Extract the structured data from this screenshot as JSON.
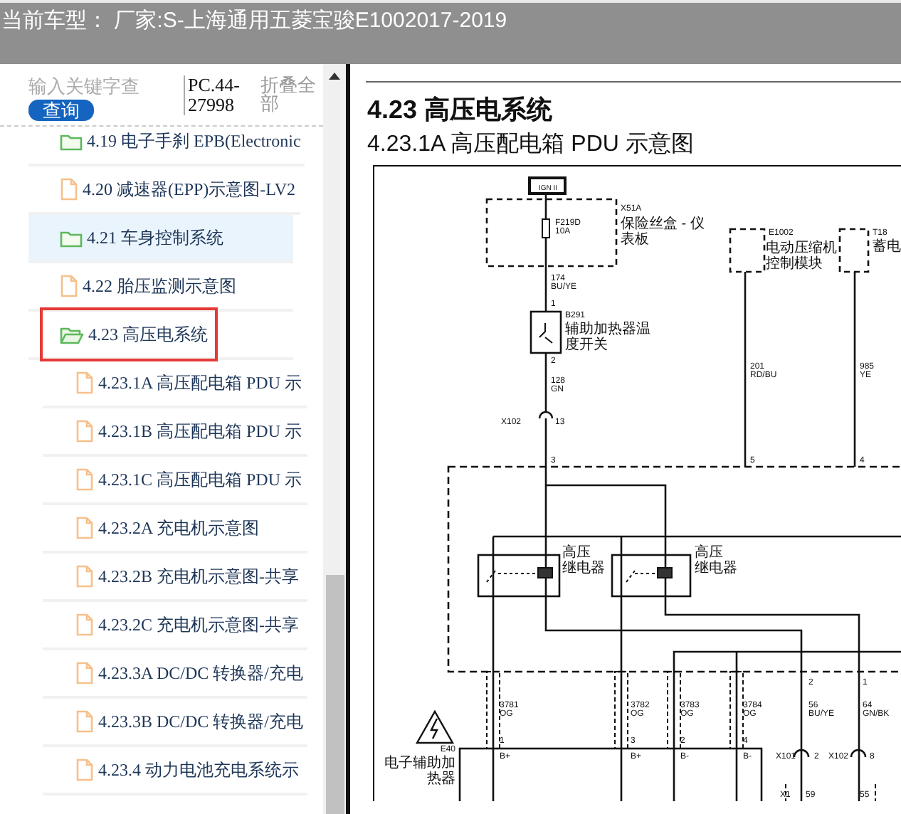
{
  "header": {
    "title": "当前车型： 厂家:S-上海通用五菱宝骏E1002017-2019"
  },
  "toolbar": {
    "search": {
      "placeholder": "输入关键字查"
    },
    "search_button": "查询",
    "code": "PC.44-27998",
    "collapse_all": "折叠全部"
  },
  "tree": [
    {
      "label": "4.19 电子手刹 EPB(Electronic",
      "kind": "folder",
      "expanded": false,
      "selected": false,
      "marked": false
    },
    {
      "label": "4.20 减速器(EPP)示意图-LV2",
      "kind": "file",
      "selected": false,
      "marked": false
    },
    {
      "label": "4.21 车身控制系统",
      "kind": "folder",
      "expanded": false,
      "selected": true,
      "marked": false
    },
    {
      "label": "4.22 胎压监测示意图",
      "kind": "file",
      "selected": false,
      "marked": false
    },
    {
      "label": "4.23 高压电系统",
      "kind": "folder",
      "expanded": true,
      "selected": false,
      "marked": true,
      "children": [
        {
          "label": "4.23.1A 高压配电箱 PDU 示",
          "kind": "file",
          "selected": false,
          "marked": false
        },
        {
          "label": "4.23.1B 高压配电箱 PDU 示",
          "kind": "file",
          "selected": false,
          "marked": false
        },
        {
          "label": "4.23.1C 高压配电箱 PDU 示",
          "kind": "file",
          "selected": false,
          "marked": false
        },
        {
          "label": "4.23.2A 充电机示意图",
          "kind": "file",
          "selected": false,
          "marked": false
        },
        {
          "label": "4.23.2B 充电机示意图-共享",
          "kind": "file",
          "selected": false,
          "marked": false
        },
        {
          "label": "4.23.2C 充电机示意图-共享",
          "kind": "file",
          "selected": false,
          "marked": false
        },
        {
          "label": "4.23.3A DC/DC 转换器/充电",
          "kind": "file",
          "selected": false,
          "marked": false
        },
        {
          "label": "4.23.3B DC/DC 转换器/充电",
          "kind": "file",
          "selected": false,
          "marked": false
        },
        {
          "label": "4.23.4 动力电池充电系统示",
          "kind": "file",
          "selected": false,
          "marked": false
        }
      ]
    }
  ],
  "document": {
    "heading": "4.23 高压电系统",
    "subheading": "4.23.1A 高压配电箱 PDU 示意图",
    "diagram": {
      "labels": [
        "IGN II",
        "X51A",
        "保险丝盒 - 仪",
        "表板",
        "F219D",
        "10A",
        "E1002",
        "电动压缩机",
        "控制模块",
        "T18",
        "蓄电",
        "174",
        "BU/YE",
        "1",
        "B291",
        "辅助加热器温",
        "度开关",
        "2",
        "128",
        "GN",
        "X102",
        "13",
        "201",
        "RD/BU",
        "985",
        "YE",
        "3",
        "5",
        "4",
        "高压",
        "继电器",
        "高压",
        "继电器",
        "3781",
        "OG",
        "3782",
        "OG",
        "3783",
        "OG",
        "3784",
        "OG",
        "2",
        "1",
        "56",
        "BU/YE",
        "64",
        "GN/BK",
        "1",
        "3",
        "2",
        "4",
        "B+",
        "B+",
        "B-",
        "B-",
        "E40",
        "电子辅助加",
        "热器",
        "X101",
        "2",
        "X102",
        "8",
        "X1",
        "59",
        "55"
      ]
    }
  }
}
